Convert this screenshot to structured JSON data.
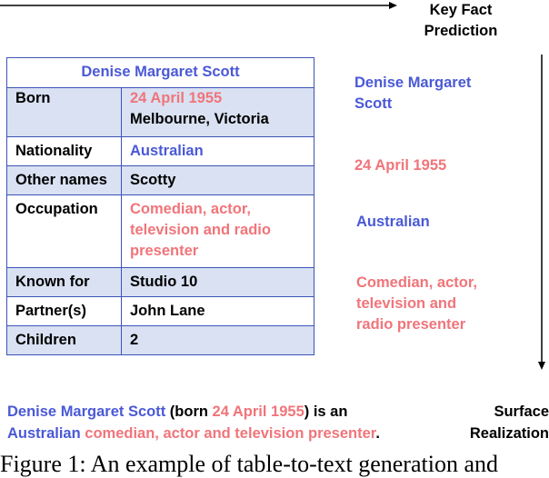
{
  "key_fact_prediction": {
    "line1": "Key Fact",
    "line2": "Prediction"
  },
  "surface_realization": {
    "line1": "Surface",
    "line2": "Realization"
  },
  "infobox": {
    "title": "Denise Margaret Scott",
    "rows": [
      {
        "key": "Born",
        "value_line1": "24 April 1955",
        "value_line2": "Melbourne, Victoria"
      },
      {
        "key": "Nationality",
        "value": "Australian"
      },
      {
        "key": "Other names",
        "value": "Scotty"
      },
      {
        "key": "Occupation",
        "value_line1": "Comedian, actor,",
        "value_line2": "television and radio",
        "value_line3": "presenter"
      },
      {
        "key": "Known for",
        "value": "Studio 10"
      },
      {
        "key": "Partner(s)",
        "value": "John Lane"
      },
      {
        "key": "Children",
        "value": "2"
      }
    ]
  },
  "key_facts": {
    "fact1_line1": "Denise Margaret",
    "fact1_line2": "Scott",
    "fact2": "24 April 1955",
    "fact3": "Australian",
    "fact4_line1": "Comedian, actor,",
    "fact4_line2": "television and",
    "fact4_line3": "radio presenter"
  },
  "sentence": {
    "name": "Denise Margaret Scott",
    "born_open": " (born ",
    "date": "24 April 1955",
    "is_an": ") is an",
    "nationality": "Australian",
    "occupation": " comedian, actor and television presenter",
    "period": "."
  },
  "caption": "Figure 1: An example of table-to-text generation and"
}
